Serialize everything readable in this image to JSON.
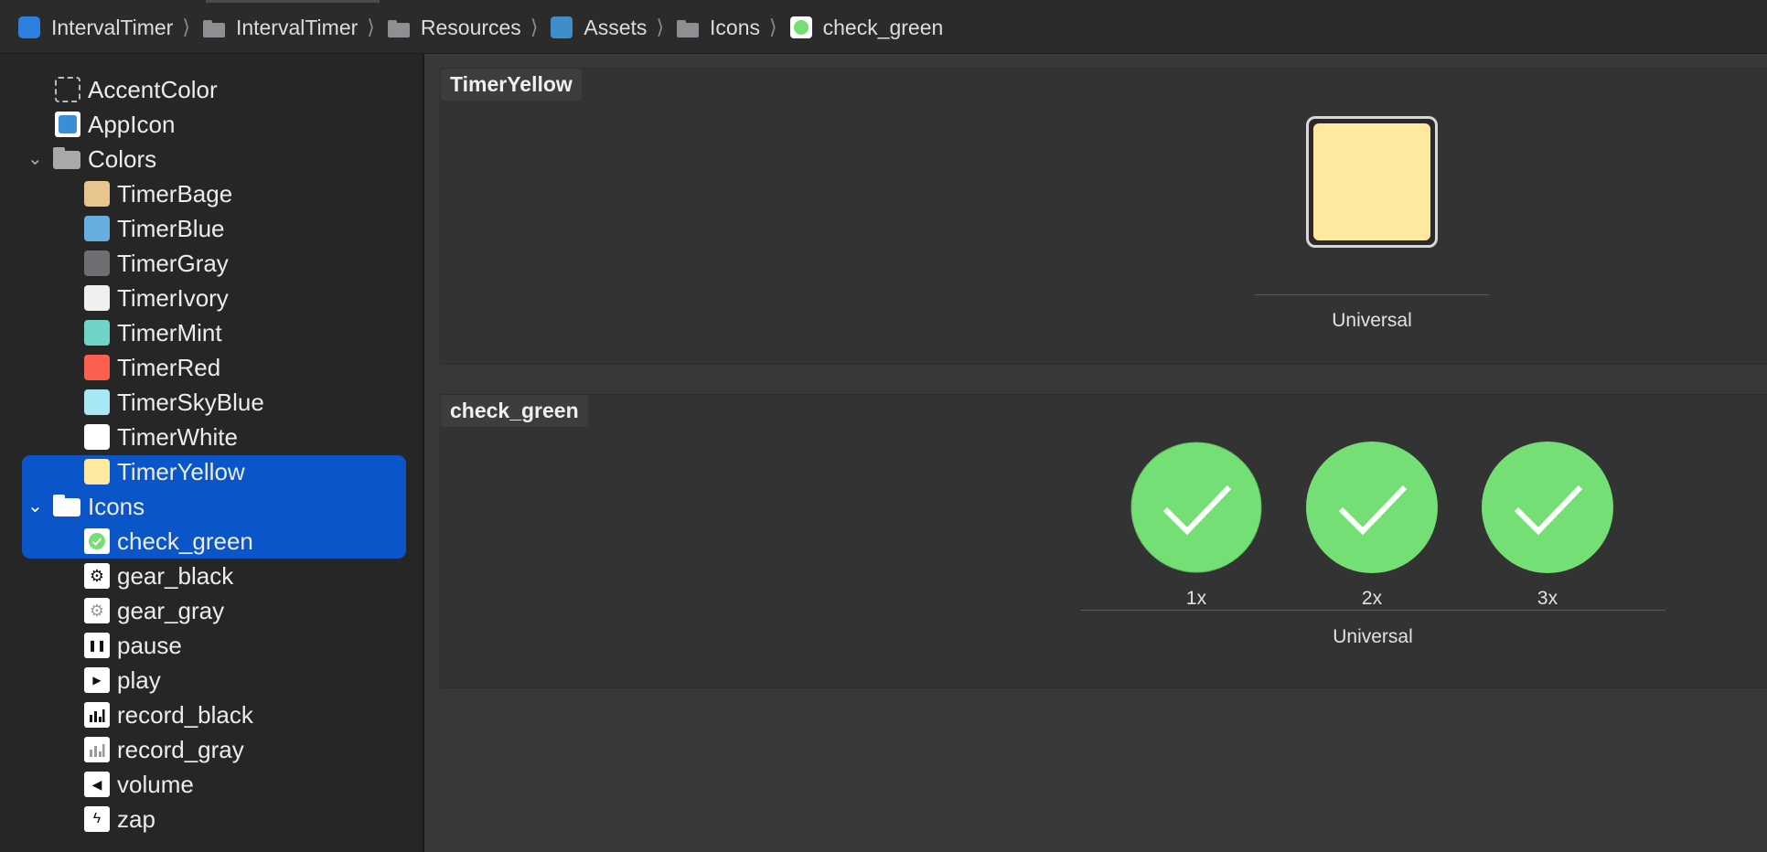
{
  "breadcrumb": [
    {
      "label": "IntervalTimer",
      "icon": "app-icon"
    },
    {
      "label": "IntervalTimer",
      "icon": "folder-icon"
    },
    {
      "label": "Resources",
      "icon": "folder-icon"
    },
    {
      "label": "Assets",
      "icon": "asset-catalog-icon"
    },
    {
      "label": "Icons",
      "icon": "folder-icon"
    },
    {
      "label": "check_green",
      "icon": "image-set-icon"
    }
  ],
  "breadcrumb_separator": "⟩",
  "sidebar": {
    "top_items": [
      {
        "label": "AccentColor",
        "icon": "dashed-color-icon"
      },
      {
        "label": "AppIcon",
        "icon": "app-icon"
      }
    ],
    "colors_group": {
      "label": "Colors",
      "expanded": true,
      "items": [
        {
          "label": "TimerBage",
          "color": "#e8c48e"
        },
        {
          "label": "TimerBlue",
          "color": "#67aee0"
        },
        {
          "label": "TimerGray",
          "color": "#6e6e73"
        },
        {
          "label": "TimerIvory",
          "color": "#f0f0f0"
        },
        {
          "label": "TimerMint",
          "color": "#6fd3c5"
        },
        {
          "label": "TimerRed",
          "color": "#fb5f4e"
        },
        {
          "label": "TimerSkyBlue",
          "color": "#a6e8f5"
        },
        {
          "label": "TimerWhite",
          "color": "#ffffff"
        },
        {
          "label": "TimerYellow",
          "color": "#ffe99e"
        }
      ]
    },
    "icons_group": {
      "label": "Icons",
      "expanded": true,
      "items": [
        {
          "label": "check_green",
          "icon": "check-circle-icon"
        },
        {
          "label": "gear_black",
          "icon": "gear-icon"
        },
        {
          "label": "gear_gray",
          "icon": "gear-icon"
        },
        {
          "label": "pause",
          "icon": "pause-icon"
        },
        {
          "label": "play",
          "icon": "play-icon"
        },
        {
          "label": "record_black",
          "icon": "bar-chart-icon"
        },
        {
          "label": "record_gray",
          "icon": "bar-chart-icon"
        },
        {
          "label": "volume",
          "icon": "volume-icon"
        },
        {
          "label": "zap",
          "icon": "zap-icon"
        }
      ]
    }
  },
  "main": {
    "color_set": {
      "title": "TimerYellow",
      "swatch_color": "#ffe99e",
      "caption": "Universal"
    },
    "image_set": {
      "title": "check_green",
      "slots": [
        "1x",
        "2x",
        "3x"
      ],
      "check_color": "#74df74",
      "caption": "Universal"
    }
  },
  "colors": {
    "selection": "#0a56c9",
    "sidebar_bg": "#262626",
    "editor_bg": "#383838"
  }
}
